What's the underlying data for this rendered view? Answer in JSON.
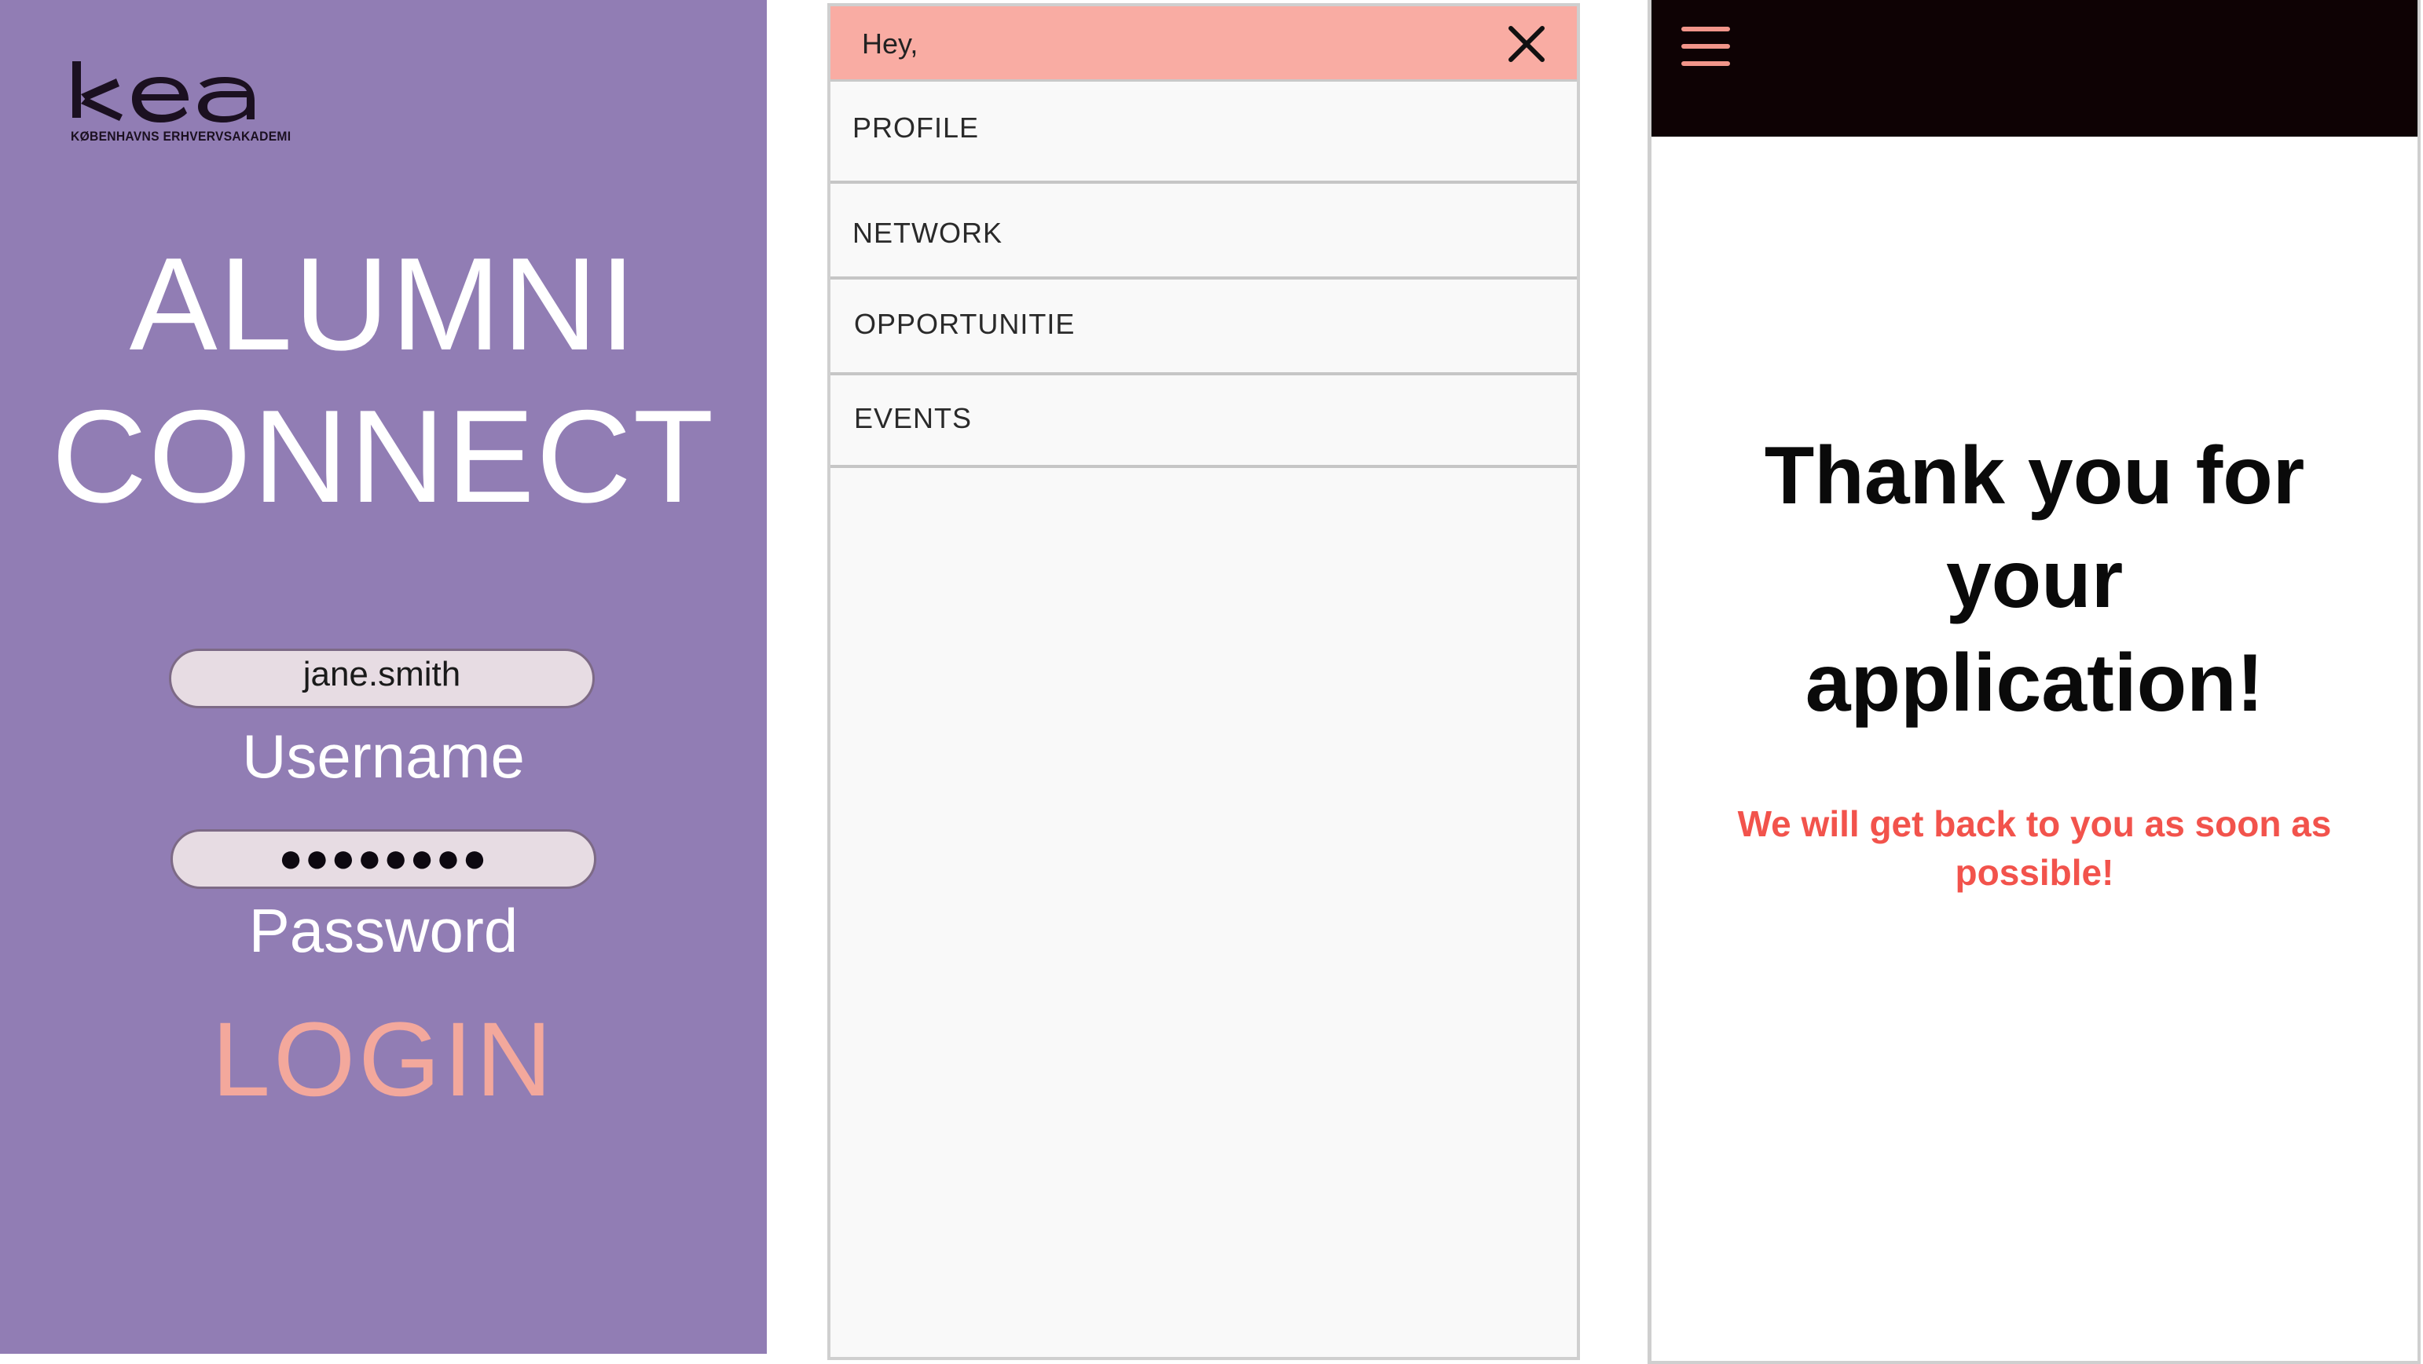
{
  "login": {
    "logo_text": "kea",
    "logo_subtitle": "KØBENHAVNS ERHVERVSAKADEMI",
    "title_line1": "ALUMNI",
    "title_line2": "CONNECT",
    "username_value": "jane.smith",
    "username_label": "Username",
    "password_value": "●●●●●●●●",
    "password_label": "Password",
    "login_button": "LOGIN"
  },
  "menu": {
    "greeting": "Hey,",
    "items": [
      {
        "label": "PROFILE"
      },
      {
        "label": "NETWORK"
      },
      {
        "label": "OPPORTUNITIE"
      },
      {
        "label": "EVENTS"
      }
    ]
  },
  "confirmation": {
    "heading": "Thank you for your application!",
    "message": "We will get back to you as soon as possible!"
  },
  "colors": {
    "login_background": "#917db4",
    "accent_pink": "#f9aca3",
    "login_button": "#f3a89c",
    "message_red": "#f2534c",
    "topbar_black": "#0e0204"
  },
  "icons": {
    "close": "close-icon",
    "menu": "hamburger-menu-icon"
  }
}
